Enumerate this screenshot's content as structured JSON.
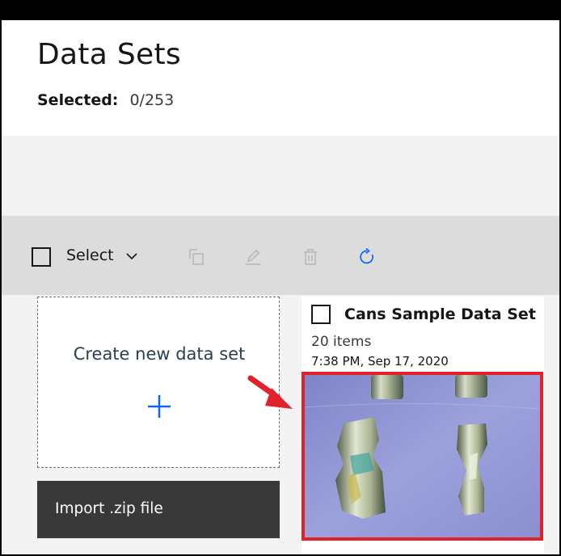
{
  "page": {
    "title": "Data Sets",
    "selected_label": "Selected:",
    "selected_value": "0/253"
  },
  "toolbar": {
    "select_label": "Select",
    "icons": [
      "duplicate-icon",
      "edit-icon",
      "delete-icon",
      "refresh-icon"
    ]
  },
  "create_card": {
    "label": "Create new data set"
  },
  "import_button": {
    "label": "Import .zip file"
  },
  "dataset_card": {
    "name": "Cans Sample Data Set",
    "items": "20 items",
    "date": "7:38 PM, Sep 17, 2020"
  },
  "colors": {
    "accent": "#0f62fe",
    "highlight_border": "#e0222b",
    "arrow": "#e0222b",
    "toolbar_bg": "#dcdcdc",
    "button_dark": "#393939"
  }
}
